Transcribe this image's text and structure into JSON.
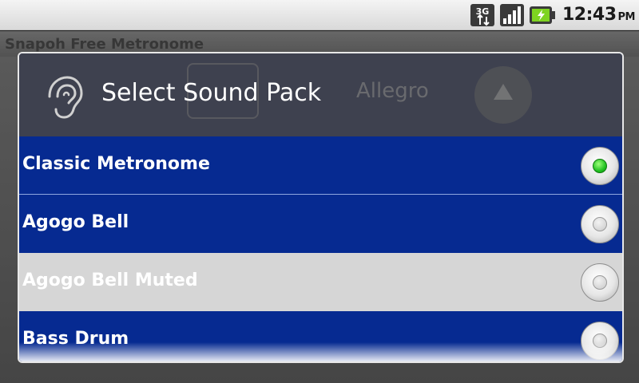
{
  "status_bar": {
    "time": "12:43",
    "ampm": "PM",
    "network_label": "3G",
    "icons": [
      "3g-data-icon",
      "signal-strength-icon",
      "battery-charging-icon"
    ]
  },
  "background_app": {
    "title": "Snapoh Free Metronome",
    "tempo_name": "Allegro"
  },
  "dialog": {
    "title": "Select Sound Pack",
    "icon": "ear-icon",
    "items": [
      {
        "label": "Classic Metronome",
        "selected": true
      },
      {
        "label": "Agogo Bell",
        "selected": false
      },
      {
        "label": "Agogo Bell Muted",
        "selected": false
      },
      {
        "label": "Bass Drum",
        "selected": false
      }
    ]
  },
  "colors": {
    "list_blue": "#062a91",
    "list_highlight": "#d6d6d6",
    "radio_checked": "#22c222"
  }
}
